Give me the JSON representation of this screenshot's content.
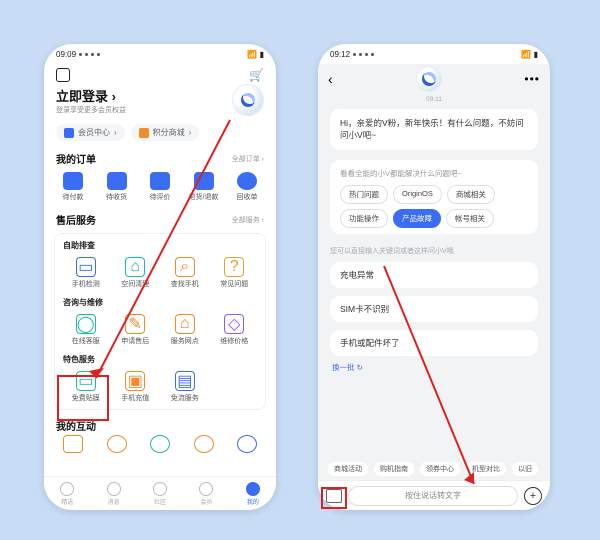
{
  "left": {
    "status_time": "09:09",
    "login_title": "立即登录",
    "login_sub": "登录享受更多会员权益",
    "pills": {
      "member": "会员中心",
      "coins": "积分商城"
    },
    "orders_title": "我的订单",
    "orders_more": "全部订单",
    "orders": [
      {
        "label": "待付款"
      },
      {
        "label": "待收货"
      },
      {
        "label": "待评价"
      },
      {
        "label": "退货/退款"
      },
      {
        "label": "回收单"
      }
    ],
    "aftersale_title": "售后服务",
    "aftersale_more": "全部服务",
    "groups": {
      "g1_title": "自助排查",
      "g1": [
        "手机检测",
        "空间清理",
        "查找手机",
        "常见问题"
      ],
      "g2_title": "咨询与维修",
      "g2": [
        "在线客服",
        "申请售后",
        "服务网点",
        "维修价格"
      ],
      "g3_title": "特色服务",
      "g3": [
        "免费贴膜",
        "手机充值",
        "免流服务"
      ]
    },
    "interact_title": "我的互动",
    "tabs": [
      "精选",
      "消息",
      "社区",
      "会员",
      "我的"
    ]
  },
  "right": {
    "status_time": "09:12",
    "ts": "09:11",
    "bubble": "Hi，亲爱的V粉，新年快乐！有什么问题，不妨问问小V吧~",
    "chips_title": "看看全能的小V都能解决什么问题吧~",
    "chips": [
      "热门问题",
      "OriginOS",
      "商城相关",
      "功能操作",
      "产品故障",
      "帐号相关"
    ],
    "chip_active_index": 4,
    "hint": "您可以直接输入关键词或者这样问小V哦",
    "qa": [
      "充电异常",
      "SIM卡不识别",
      "手机或配件坏了"
    ],
    "refresh": "换一批 ↻",
    "tags": [
      "商城活动",
      "购机指南",
      "领券中心",
      "机型对比",
      "以旧"
    ],
    "input_placeholder": "按住说话转文字"
  }
}
